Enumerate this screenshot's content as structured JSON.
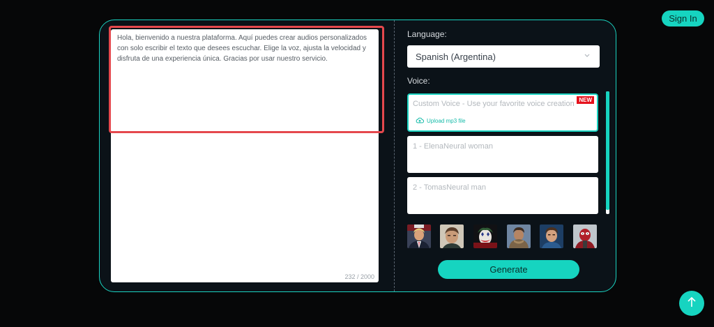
{
  "header": {
    "sign_in_label": "Sign In"
  },
  "editor": {
    "text": "Hola, bienvenido a nuestra plataforma. Aquí puedes crear audios personalizados con solo escribir el texto que desees escuchar. Elige la voz, ajusta la velocidad y disfruta de una experiencia única. Gracias por usar nuestro servicio.",
    "counter": "232 / 2000"
  },
  "settings": {
    "language_label": "Language:",
    "language_value": "Spanish (Argentina)",
    "voice_label": "Voice:"
  },
  "voices": {
    "custom": {
      "name": "Custom Voice - Use your favorite voice creation",
      "badge": "NEW",
      "upload_label": "Upload mp3 file"
    },
    "items": [
      {
        "name": "1 - ElenaNeural woman"
      },
      {
        "name": "2 - TomasNeural man"
      }
    ]
  },
  "avatars": [
    {
      "icon": "avatar-man-suit"
    },
    {
      "icon": "avatar-man-portrait"
    },
    {
      "icon": "avatar-joker"
    },
    {
      "icon": "avatar-man-scarf"
    },
    {
      "icon": "avatar-man-blue"
    },
    {
      "icon": "avatar-red-masked"
    }
  ],
  "actions": {
    "generate_label": "Generate"
  },
  "colors": {
    "accent": "#16d4c0",
    "highlight": "#e5484d",
    "background": "#060708",
    "badge": "#e5121d"
  }
}
